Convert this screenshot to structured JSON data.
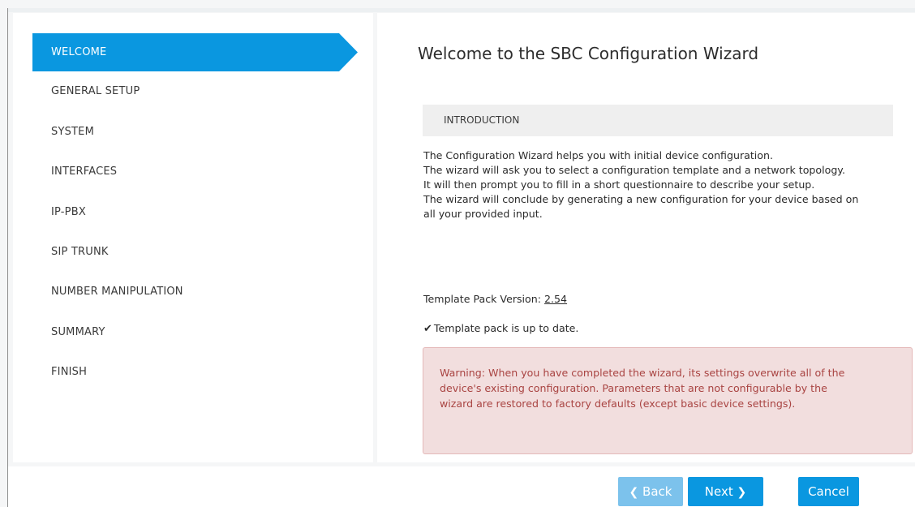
{
  "sidebar": {
    "active_item": "WELCOME",
    "items": [
      "GENERAL SETUP",
      "SYSTEM",
      "INTERFACES",
      "IP-PBX",
      "SIP TRUNK",
      "NUMBER MANIPULATION",
      "SUMMARY",
      "FINISH"
    ]
  },
  "main": {
    "title": "Welcome to the SBC Configuration Wizard",
    "section_header": "INTRODUCTION",
    "intro_lines": [
      "The Configuration Wizard helps you with initial device configuration.",
      "The wizard will ask you to select a configuration template and a network topology.",
      "It will then prompt you to fill in a short questionnaire to describe your setup.",
      "The wizard will conclude by generating a new configuration for your device based on",
      "all your provided input."
    ],
    "template_version_label": "Template Pack Version:",
    "template_version_value": "2.54",
    "status_text": "Template pack is up to date.",
    "warning_lines": [
      "Warning: When you have completed the wizard, its settings overwrite all of the",
      "device's existing configuration. Parameters that are not configurable by the",
      "wizard are restored to factory defaults (except basic device settings)."
    ]
  },
  "footer": {
    "back_label": "Back",
    "next_label": "Next",
    "cancel_label": "Cancel"
  },
  "icons": {
    "check": "check-icon",
    "back": "chevron-left-icon",
    "next": "chevron-right-icon"
  },
  "colors": {
    "accent": "#0a97e0",
    "accent_disabled": "#7cc2ec",
    "warning_bg": "#f2dede",
    "warning_text": "#a94442"
  }
}
